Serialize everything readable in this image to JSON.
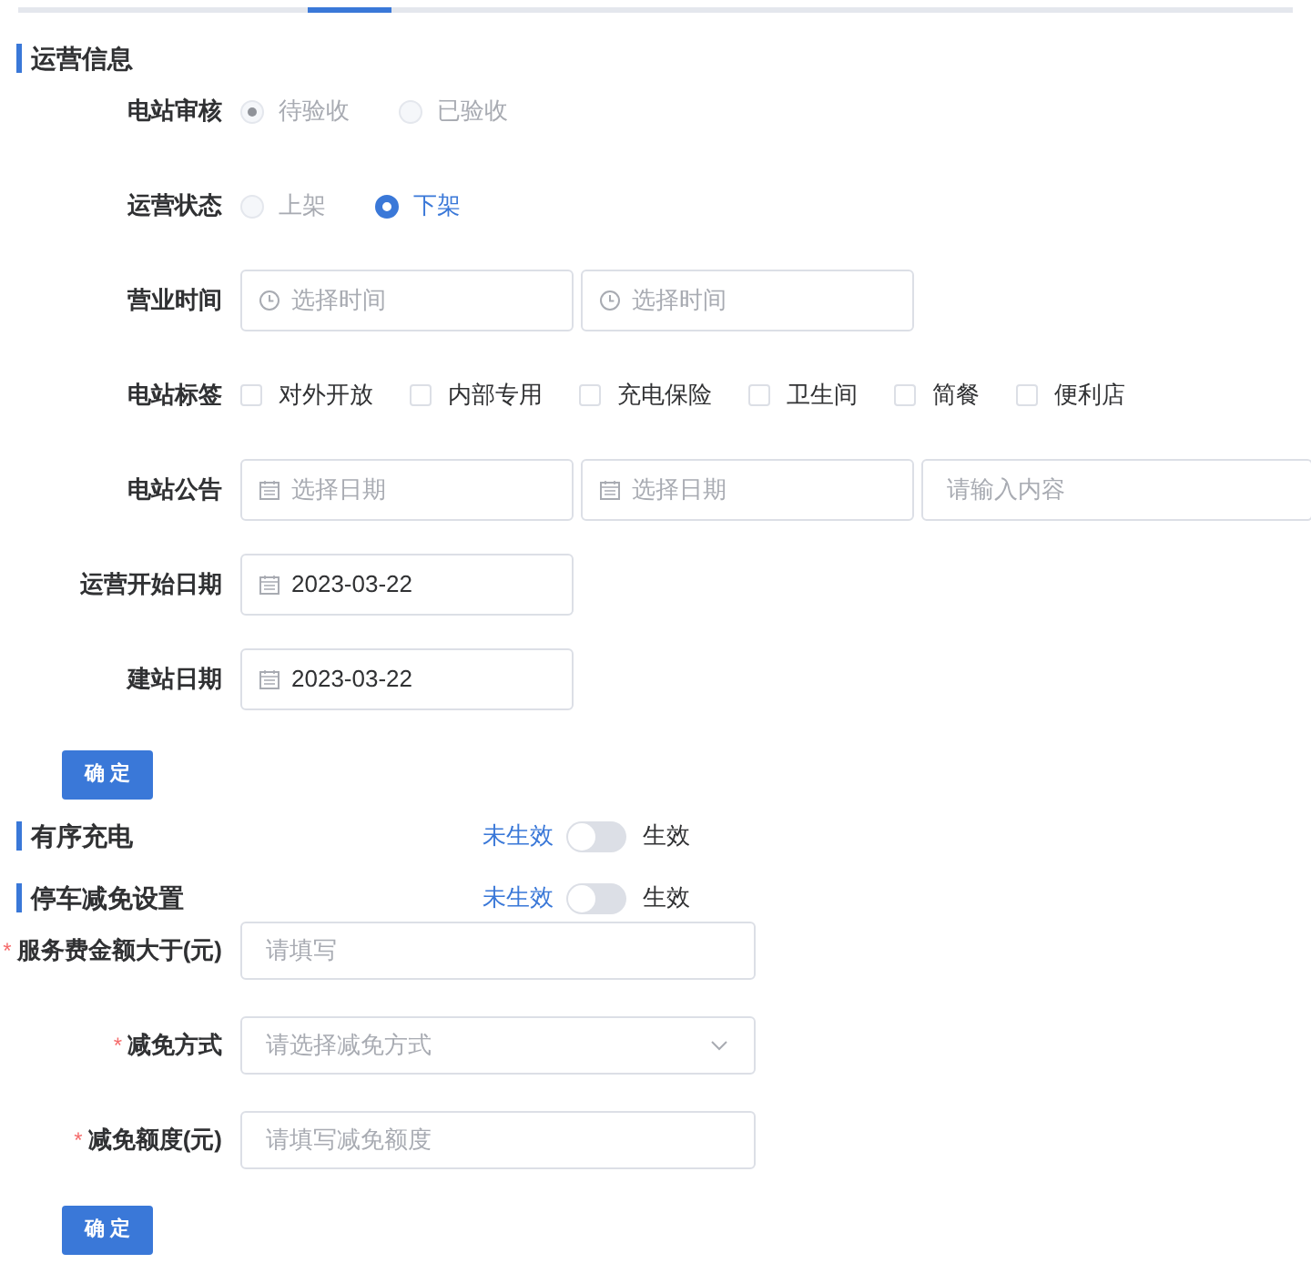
{
  "operation": {
    "title": "运营信息",
    "fields": [
      {
        "kind": "radio",
        "label": "电站审核",
        "options": [
          {
            "label": "待验收",
            "selected": true,
            "disabled": true
          },
          {
            "label": "已验收",
            "selected": false,
            "disabled": true
          }
        ]
      },
      {
        "kind": "radio",
        "label": "运营状态",
        "options": [
          {
            "label": "上架",
            "selected": false,
            "disabled": true
          },
          {
            "label": "下架",
            "selected": true,
            "disabled": false
          }
        ]
      },
      {
        "kind": "inputs",
        "label": "营业时间",
        "inputs": [
          {
            "kind": "time",
            "placeholder": "选择时间"
          },
          {
            "kind": "time",
            "placeholder": "选择时间"
          }
        ]
      },
      {
        "kind": "checkboxes",
        "label": "电站标签",
        "options": [
          {
            "label": "对外开放",
            "checked": false
          },
          {
            "label": "内部专用",
            "checked": false
          },
          {
            "label": "充电保险",
            "checked": false
          },
          {
            "label": "卫生间",
            "checked": false
          },
          {
            "label": "简餐",
            "checked": false
          },
          {
            "label": "便利店",
            "checked": false
          }
        ]
      },
      {
        "kind": "inputs",
        "label": "电站公告",
        "inputs": [
          {
            "kind": "date",
            "placeholder": "选择日期"
          },
          {
            "kind": "date",
            "placeholder": "选择日期"
          },
          {
            "kind": "text",
            "placeholder": "请输入内容"
          }
        ]
      },
      {
        "kind": "inputs",
        "label": "运营开始日期",
        "inputs": [
          {
            "kind": "date",
            "value": "2023-03-22"
          }
        ]
      },
      {
        "kind": "inputs",
        "label": "建站日期",
        "inputs": [
          {
            "kind": "date",
            "value": "2023-03-22"
          }
        ]
      }
    ],
    "button": "确 定"
  },
  "ordered_charging": {
    "title": "有序充电",
    "switch": {
      "off_label": "未生效",
      "on_label": "生效",
      "on": false
    }
  },
  "parking": {
    "title": "停车减免设置",
    "switch": {
      "off_label": "未生效",
      "on_label": "生效",
      "on": false
    },
    "fields": [
      {
        "kind": "text",
        "label": "服务费金额大于(元)",
        "required_mark": "*",
        "placeholder": "请填写"
      },
      {
        "kind": "select",
        "label": "减免方式",
        "required_mark": "*",
        "placeholder": "请选择减免方式"
      },
      {
        "kind": "text",
        "label": "减免额度(元)",
        "required_mark": "*",
        "placeholder": "请填写减免额度"
      }
    ],
    "button": "确 定"
  }
}
